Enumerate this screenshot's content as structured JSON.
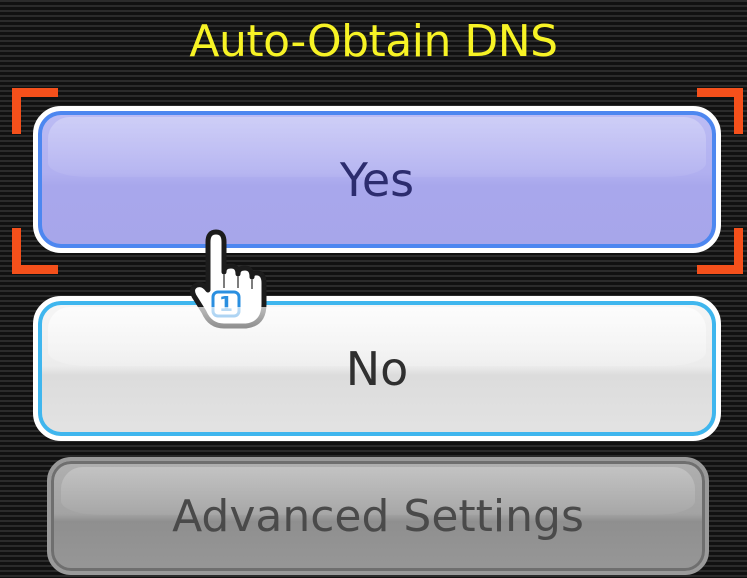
{
  "dialog": {
    "title": "Auto-Obtain DNS"
  },
  "options": {
    "yes_label": "Yes",
    "no_label": "No",
    "advanced_label": "Advanced Settings"
  },
  "selection": {
    "highlighted": "Yes",
    "bracket_color": "#f5501b"
  },
  "cursor": {
    "icon": "hand-pointer-icon",
    "player_number": "1",
    "accent_color": "#2a8fe0"
  },
  "colors": {
    "title": "#f7f325",
    "yes_fill": "#b1b0f0",
    "yes_border": "#4d87f0",
    "no_fill": "#ececec",
    "no_border": "#3fb6ee",
    "advanced_fill": "#a3a3a3"
  }
}
